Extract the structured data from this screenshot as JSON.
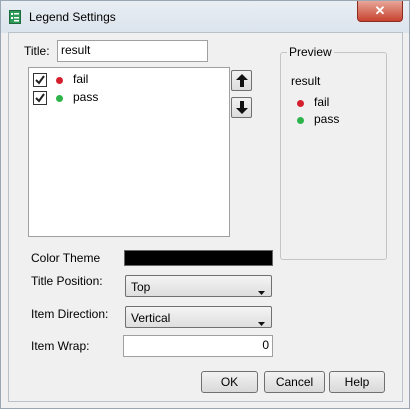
{
  "window": {
    "title": "Legend Settings",
    "close_glyph": "✕"
  },
  "form": {
    "title_label": "Title:",
    "title_value": "result",
    "items": [
      {
        "label": "fail",
        "checked": true,
        "color": "#d4202c"
      },
      {
        "label": "pass",
        "checked": true,
        "color": "#2db34a"
      }
    ],
    "move_up_icon": "arrow-up-icon",
    "move_down_icon": "arrow-down-icon",
    "color_theme_label": "Color Theme",
    "color_theme_swatch": "#000000",
    "title_position_label": "Title Position:",
    "title_position_value": "Top",
    "item_direction_label": "Item Direction:",
    "item_direction_value": "Vertical",
    "item_wrap_label": "Item Wrap:",
    "item_wrap_value": "0"
  },
  "preview": {
    "legend": "Preview",
    "title": "result",
    "items": [
      {
        "label": "fail",
        "color": "#d4202c"
      },
      {
        "label": "pass",
        "color": "#2db34a"
      }
    ]
  },
  "buttons": {
    "ok": "OK",
    "cancel": "Cancel",
    "help": "Help"
  }
}
